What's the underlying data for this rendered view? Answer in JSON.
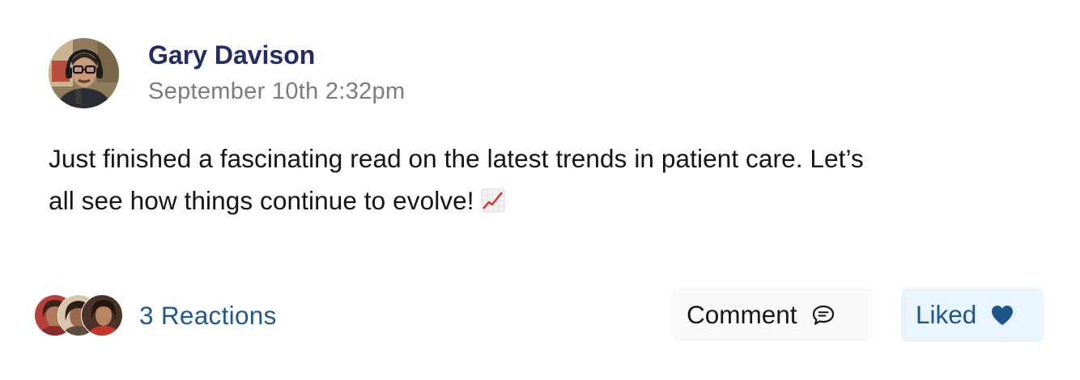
{
  "post": {
    "author_name": "Gary Davison",
    "timestamp": "September 10th 2:32pm",
    "body_line_1": "Just finished a fascinating read on the latest trends in patient care. Let’s",
    "body_line_2": "all see how things continue to evolve!",
    "emoji_icon": "chart-increasing-emoji"
  },
  "reactions": {
    "count_label": "3 Reactions",
    "reactor_count": 3
  },
  "actions": {
    "comment_label": "Comment",
    "comment_icon": "speech-bubble-icon",
    "liked_label": "Liked",
    "liked_icon": "heart-icon"
  },
  "colors": {
    "author_name": "#252b66",
    "timestamp": "#7c7c7c",
    "reaction_link": "#1f5891",
    "liked_text": "#1e568c",
    "liked_bg": "#e9f4fd",
    "comment_bg": "#f9f9f9"
  }
}
